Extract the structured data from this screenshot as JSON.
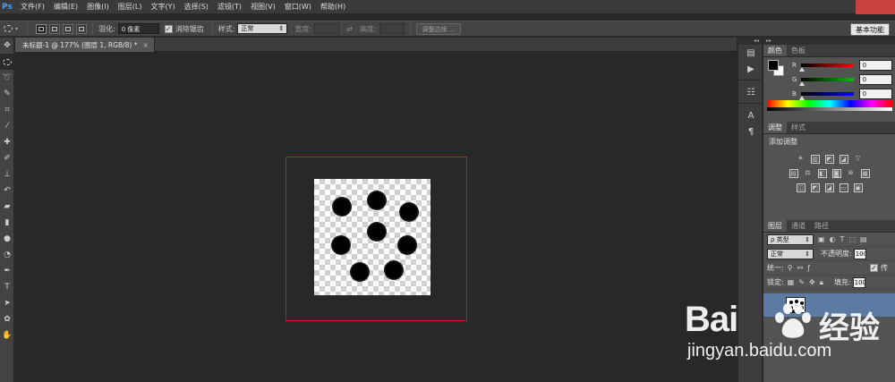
{
  "app": {
    "logo": "Ps"
  },
  "menu": [
    "文件(F)",
    "编辑(E)",
    "图像(I)",
    "图层(L)",
    "文字(Y)",
    "选择(S)",
    "滤镜(T)",
    "视图(V)",
    "窗口(W)",
    "帮助(H)"
  ],
  "options": {
    "feather_label": "羽化:",
    "feather_value": "0 像素",
    "antialias_label": "消除锯齿",
    "antialias_checked": true,
    "style_label": "样式:",
    "style_value": "正常",
    "width_label": "宽度:",
    "height_label": "高度:",
    "refine_button": "调整边缘 ...",
    "workspace_button": "基本功能"
  },
  "document": {
    "tab_title": "未标题-1 @ 177% (图层 1, RGB/8) *",
    "close": "×"
  },
  "color_panel": {
    "tabs": [
      "颜色",
      "色板"
    ],
    "channels": [
      {
        "name": "R",
        "value": "0",
        "color": "#ff0000"
      },
      {
        "name": "G",
        "value": "0",
        "color": "#00c000"
      },
      {
        "name": "B",
        "value": "0",
        "color": "#0000ff"
      }
    ]
  },
  "adjust_panel": {
    "tabs": [
      "调整",
      "样式"
    ],
    "title": "添加调整"
  },
  "layers_panel": {
    "tabs": [
      "图层",
      "通道",
      "路径"
    ],
    "filter_label": "ρ 类型",
    "blend_mode": "正常",
    "opacity_label": "不透明度:",
    "opacity_value": "100",
    "unify_label": "统一:",
    "propagate_label": "传",
    "lock_label": "锁定:",
    "fill_label": "填充:",
    "fill_value": "100"
  },
  "watermark": {
    "text_bai": "Bai",
    "text_jy": "经验",
    "url": "jingyan.baidu.com"
  },
  "colors": {
    "highlight": "#d01515",
    "accent": "#3ea3ff",
    "layer_selected": "#5d7aa2"
  }
}
